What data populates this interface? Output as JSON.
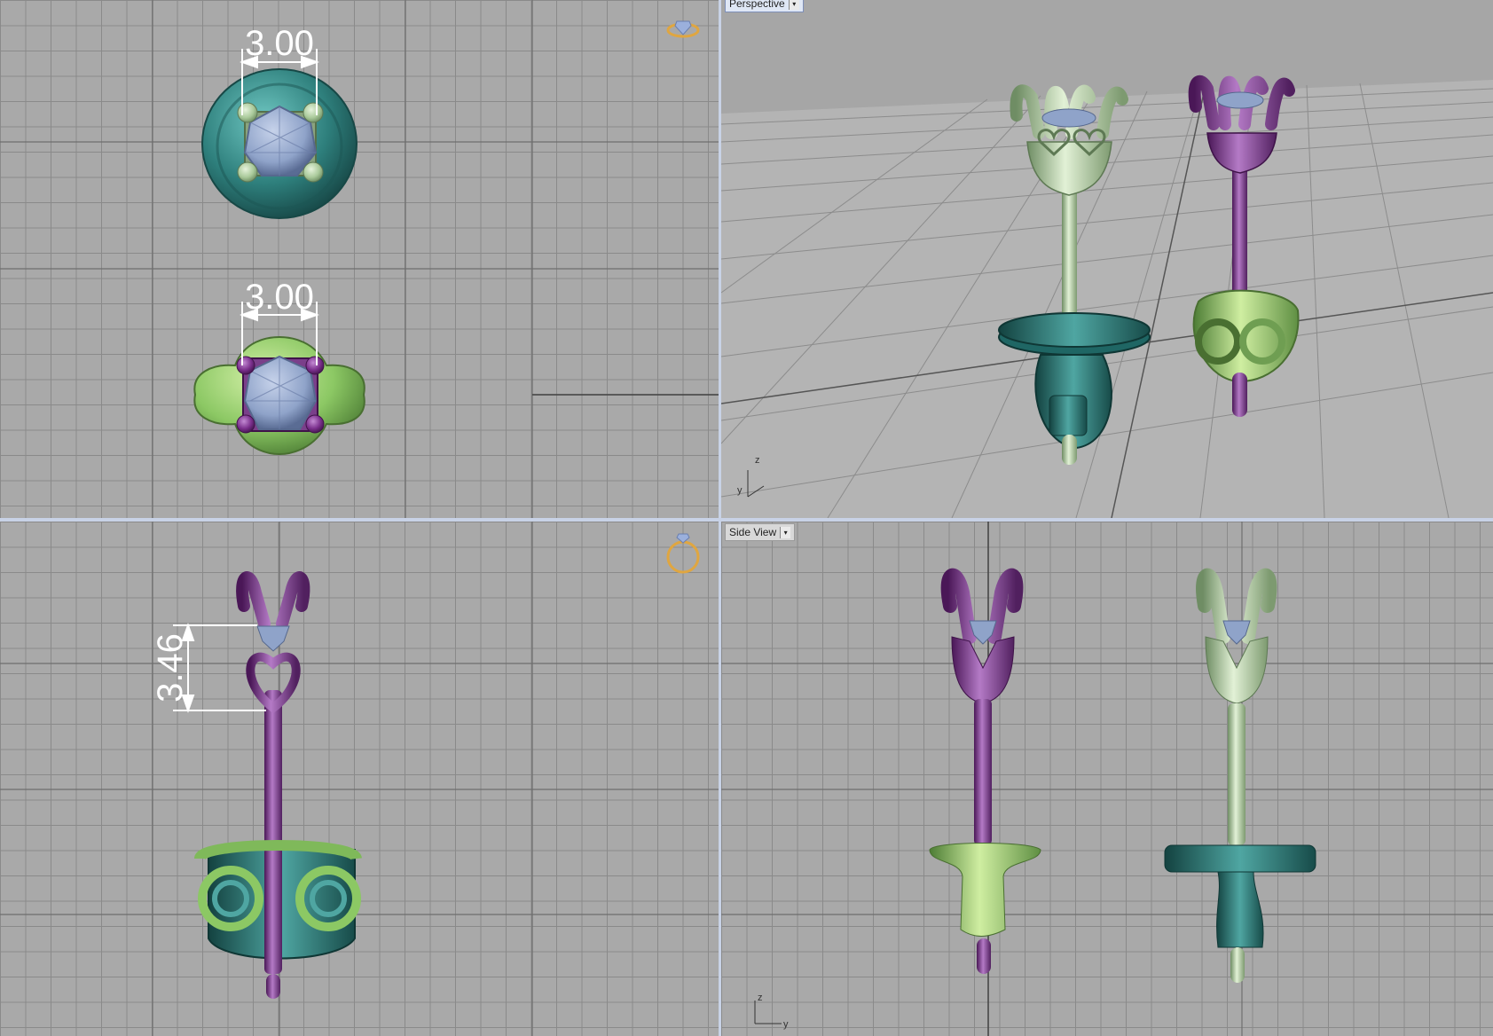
{
  "viewports": {
    "top_left": {
      "dimension_top": "3.00",
      "dimension_bottom": "3.00"
    },
    "top_right": {
      "label": "Perspective",
      "axis_z": "z",
      "axis_y": "y"
    },
    "bottom_left": {
      "dimension": "3.46"
    },
    "bottom_right": {
      "label": "Side View",
      "axis_z": "z",
      "axis_y": "y"
    }
  },
  "colors": {
    "teal": "#2e7f7c",
    "lime_green": "#8cc864",
    "sage_green": "#a9c99a",
    "purple": "#7a2f8c",
    "gem_blue": "#8fa3c9",
    "grid_bg": "#a9a9a9",
    "viewport_border": "#c8d2e6"
  },
  "icons": [
    "diamond-ring-icon",
    "ring-icon",
    "dropdown-arrow-icon"
  ]
}
